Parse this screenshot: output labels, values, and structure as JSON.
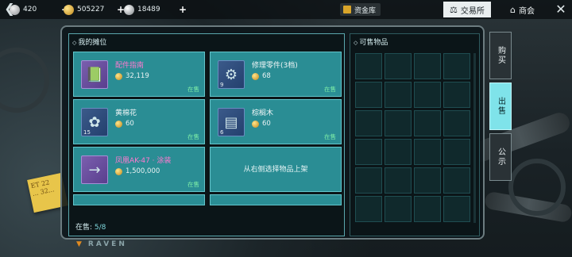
{
  "topbar": {
    "currency1": "420",
    "currency2": "505227",
    "currency3": "18489",
    "vault_label": "资金库",
    "tab_trade": "交易所",
    "tab_shop": "商会"
  },
  "left_panel": {
    "title": "我的摊位",
    "cards": [
      {
        "name": "配件指南",
        "price": "32,119",
        "status": "在售",
        "count": ""
      },
      {
        "name": "修理零件(3档)",
        "price": "68",
        "status": "在售",
        "count": "9"
      },
      {
        "name": "黄棉花",
        "price": "60",
        "status": "在售",
        "count": "15"
      },
      {
        "name": "棕榈木",
        "price": "60",
        "status": "在售",
        "count": "6"
      },
      {
        "name": "凤凰AK-47 · 涂装",
        "price": "1,500,000",
        "status": "在售",
        "count": ""
      }
    ],
    "empty_hint": "从右侧选择物品上架",
    "on_sale_label": "在售:",
    "on_sale_value": "5/8"
  },
  "right_panel": {
    "title": "可售物品"
  },
  "side_tabs": {
    "buy": "购买",
    "sell": "出售",
    "notice": "公示"
  },
  "branding": {
    "logo": "RAVEN"
  },
  "note": {
    "text": "ET 22 ... 32..."
  }
}
